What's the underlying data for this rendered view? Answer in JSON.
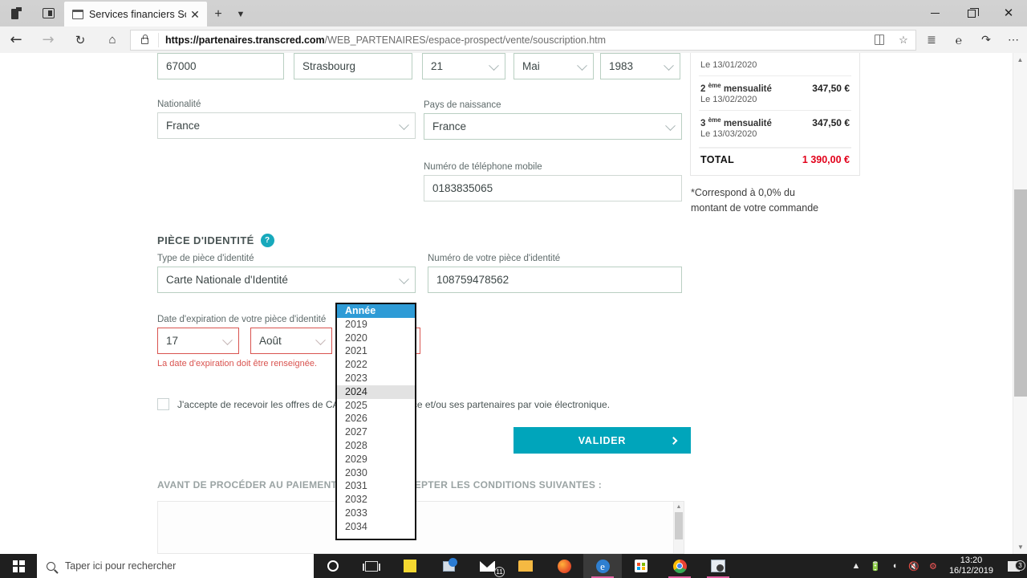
{
  "browser": {
    "tab_title": "Services financiers Sofin",
    "url_domain": "https://partenaires.transcred.com",
    "url_path": "/WEB_PARTENAIRES/espace-prospect/vente/souscription.htm",
    "icons": {
      "back": "back-arrow-icon",
      "forward": "forward-arrow-icon",
      "reload": "reload-icon",
      "home": "home-icon",
      "lock": "lock-icon",
      "reading_view": "reading-view-icon",
      "favorite": "star-icon",
      "favorites_hub": "favorites-hub-icon",
      "notes": "web-notes-icon",
      "share": "share-icon",
      "more": "more-options-icon",
      "minimize": "minimize-icon",
      "maximize": "restore-icon",
      "close": "close-icon",
      "new_tab": "+",
      "tab_menu": "chevron-down-icon"
    }
  },
  "form": {
    "postal_code": "67000",
    "city": "Strasbourg",
    "birth_day": "21",
    "birth_month": "Mai",
    "birth_year": "1983",
    "nationality_label": "Nationalité",
    "nationality_value": "France",
    "birth_country_label": "Pays de naissance",
    "birth_country_value": "France",
    "mobile_label": "Numéro de téléphone mobile",
    "mobile_value": "0183835065"
  },
  "identity": {
    "section_title": "PIÈCE D'IDENTITÉ",
    "help_glyph": "?",
    "type_label": "Type de pièce d'identité",
    "type_value": "Carte Nationale d'Identité",
    "number_label": "Numéro de votre pièce d'identité",
    "number_value": "108759478562",
    "expiry_label": "Date d'expiration de votre pièce d'identité",
    "expiry_day": "17",
    "expiry_month": "Août",
    "expiry_error": "La date d'expiration doit être renseignée."
  },
  "year_dropdown": {
    "selected": "Année",
    "hovered": "2024",
    "options": [
      "Année",
      "2019",
      "2020",
      "2021",
      "2022",
      "2023",
      "2024",
      "2025",
      "2026",
      "2027",
      "2028",
      "2029",
      "2030",
      "2031",
      "2032",
      "2033",
      "2034"
    ]
  },
  "optin": {
    "text": "J'accepte de recevoir les offres de CA Consumer Finance et/ou ses partenaires par voie électronique."
  },
  "submit": {
    "label": "VALIDER",
    "chevron": "chevron-right-icon",
    "color": "#00a5bb"
  },
  "conditions": {
    "title": "AVANT DE PROCÉDER AU PAIEMENT, VEUILLEZ ACCEPTER LES CONDITIONS SUIVANTES :"
  },
  "recap": {
    "rows": [
      {
        "label": "",
        "sup": "",
        "amount": "",
        "date": "Le 13/01/2020"
      },
      {
        "label": "mensualité",
        "sup": "2",
        "sup_ord": "ème",
        "amount": "347,50 €",
        "date": "Le 13/02/2020"
      },
      {
        "label": "mensualité",
        "sup": "3",
        "sup_ord": "ème",
        "amount": "347,50 €",
        "date": "Le 13/03/2020"
      }
    ],
    "total_label": "TOTAL",
    "total_amount": "1 390,00 €",
    "total_color": "#e2001a",
    "note": "*Correspond à 0,0% du montant de votre commande"
  },
  "taskbar": {
    "search_placeholder": "Taper ici pour rechercher",
    "time": "13:20",
    "date": "16/12/2019",
    "notification_count": "3",
    "mail_badge": "11",
    "icons": [
      "cortana-icon",
      "task-view-icon",
      "sticky-notes-icon",
      "remote-desktop-icon",
      "mail-icon",
      "file-explorer-icon",
      "firefox-icon",
      "edge-icon",
      "microsoft-store-icon",
      "chrome-icon",
      "app-icon"
    ],
    "tray_icons": [
      "show-hidden-icons-chevron",
      "battery-icon",
      "wifi-icon",
      "volume-muted-icon",
      "security-icon"
    ]
  }
}
